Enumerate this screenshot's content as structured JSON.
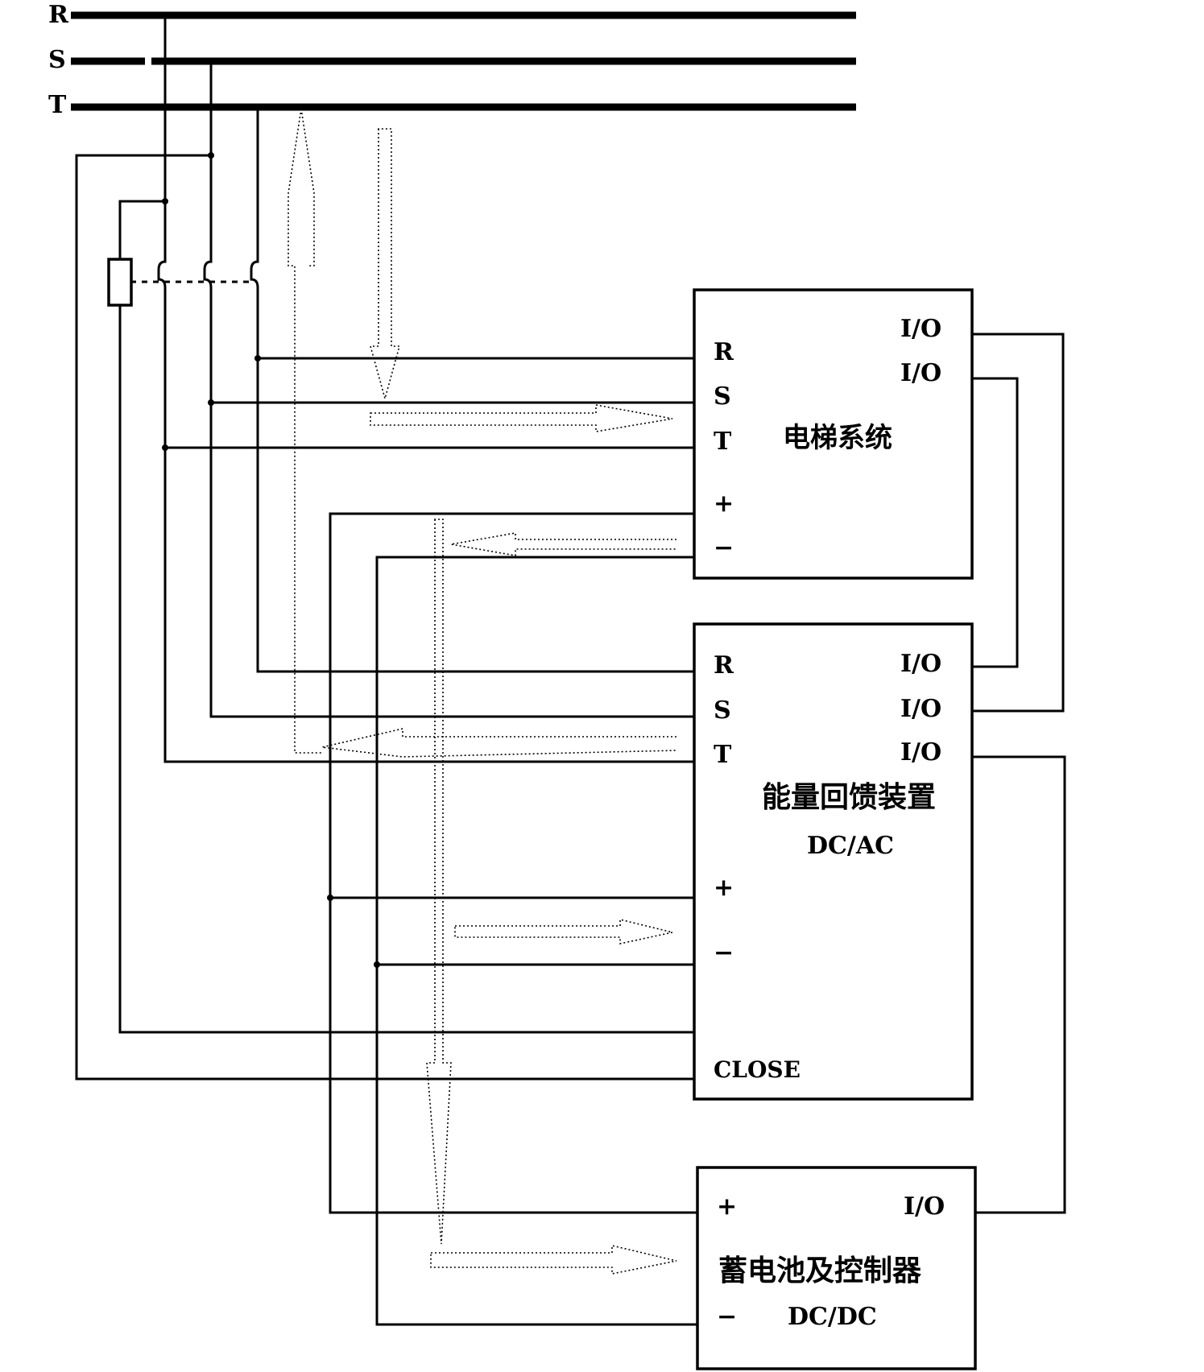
{
  "bus": {
    "phases": [
      "R",
      "S",
      "T"
    ]
  },
  "elevator": {
    "title": "电梯系统",
    "left_ports": [
      "R",
      "S",
      "T",
      "+",
      "−"
    ],
    "right_ports": [
      "I/O",
      "I/O"
    ]
  },
  "feedback": {
    "title": "能量回馈装置",
    "subtitle": "DC/AC",
    "left_ports": [
      "R",
      "S",
      "T",
      "+",
      "−",
      "CLOSE"
    ],
    "right_ports": [
      "I/O",
      "I/O",
      "I/O"
    ]
  },
  "battery": {
    "title": "蓄电池及控制器",
    "subtitle": "DC/DC",
    "left_ports": [
      "+",
      "−"
    ],
    "right_ports": [
      "I/O"
    ]
  },
  "colors": {
    "line": "#000000",
    "background": "#ffffff"
  }
}
